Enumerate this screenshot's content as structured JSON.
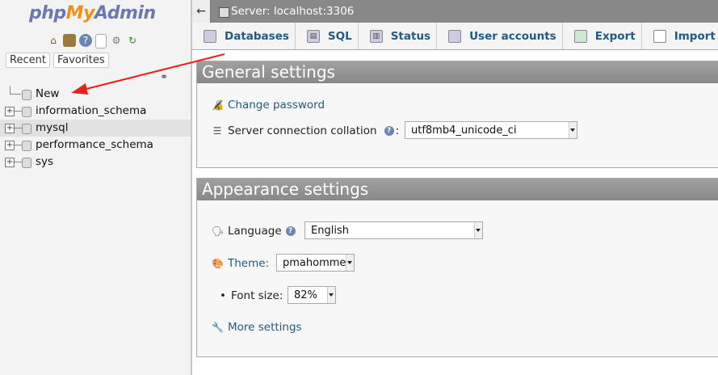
{
  "nav": {
    "logo": {
      "php": "php",
      "my": "My",
      "admin": "Admin"
    },
    "tabs": [
      "Recent",
      "Favorites"
    ],
    "tree": [
      {
        "label": "New"
      },
      {
        "label": "information_schema"
      },
      {
        "label": "mysql",
        "selected": true
      },
      {
        "label": "performance_schema"
      },
      {
        "label": "sys"
      }
    ]
  },
  "topbar": {
    "title": "Server: localhost:3306"
  },
  "menu": [
    {
      "label": "Databases",
      "icon": "database-icon"
    },
    {
      "label": "SQL",
      "icon": "sql-icon"
    },
    {
      "label": "Status",
      "icon": "status-icon"
    },
    {
      "label": "User accounts",
      "icon": "users-icon"
    },
    {
      "label": "Export",
      "icon": "export-icon"
    },
    {
      "label": "Import",
      "icon": "import-icon"
    }
  ],
  "general": {
    "title": "General settings",
    "change_password": "Change password",
    "collation_label": "Server connection collation",
    "collation_colon": ":",
    "collation_value": "utf8mb4_unicode_ci"
  },
  "appearance": {
    "title": "Appearance settings",
    "language_label": "Language",
    "language_value": "English",
    "theme_label": "Theme:",
    "theme_value": "pmahomme",
    "fontsize_label": "Font size:",
    "fontsize_value": "82%",
    "more_settings": "More settings"
  },
  "colors": {
    "link": "#235a81",
    "arrow": "#e8211d",
    "logo_blue": "#6c78af",
    "logo_orange": "#f29111"
  }
}
